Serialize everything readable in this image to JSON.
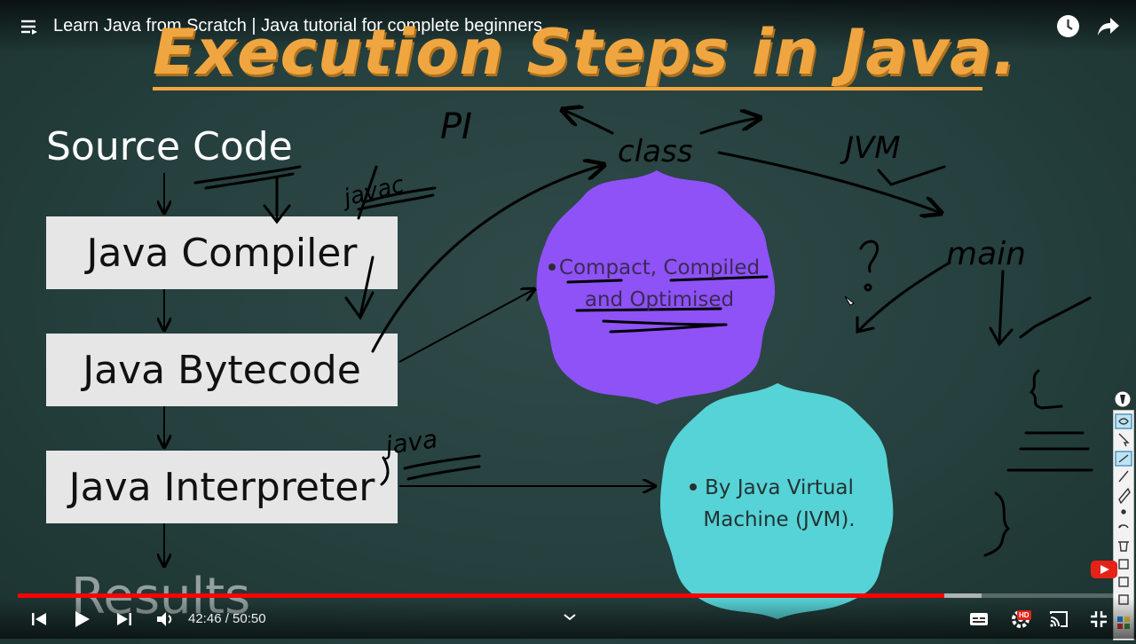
{
  "header": {
    "video_title": "Learn Java from Scratch | Java tutorial for complete beginners.",
    "menu_icon": "playlist-menu-icon",
    "watch_later_icon": "clock-icon",
    "share_icon": "share-arrow-icon"
  },
  "slide": {
    "title": "Execution Steps in Java.",
    "source_code": "Source Code",
    "steps": [
      "Java Compiler",
      "Java Bytecode",
      "Java Interpreter"
    ],
    "results": "Results",
    "purple_note": "Compact, Compiled and Optimised",
    "teal_note": "By Java Virtual Machine (JVM).",
    "colors": {
      "title": "#f0a640",
      "purple_blob": "#8e52f7",
      "teal_blob": "#56d3d6",
      "box": "#e6e6e6"
    }
  },
  "handwriting": {
    "pi": "PI",
    "class": "class",
    "jvm": "JVM",
    "javac": "javac",
    "java": "java",
    "main": "main"
  },
  "player": {
    "time_current": "42:46",
    "time_total": "50:50",
    "time_display": "42:46 / 50:50",
    "progress_fraction": 0.842,
    "buffered_fraction": 0.876,
    "hd_badge": "HD",
    "progress_color": "#ff0000"
  }
}
